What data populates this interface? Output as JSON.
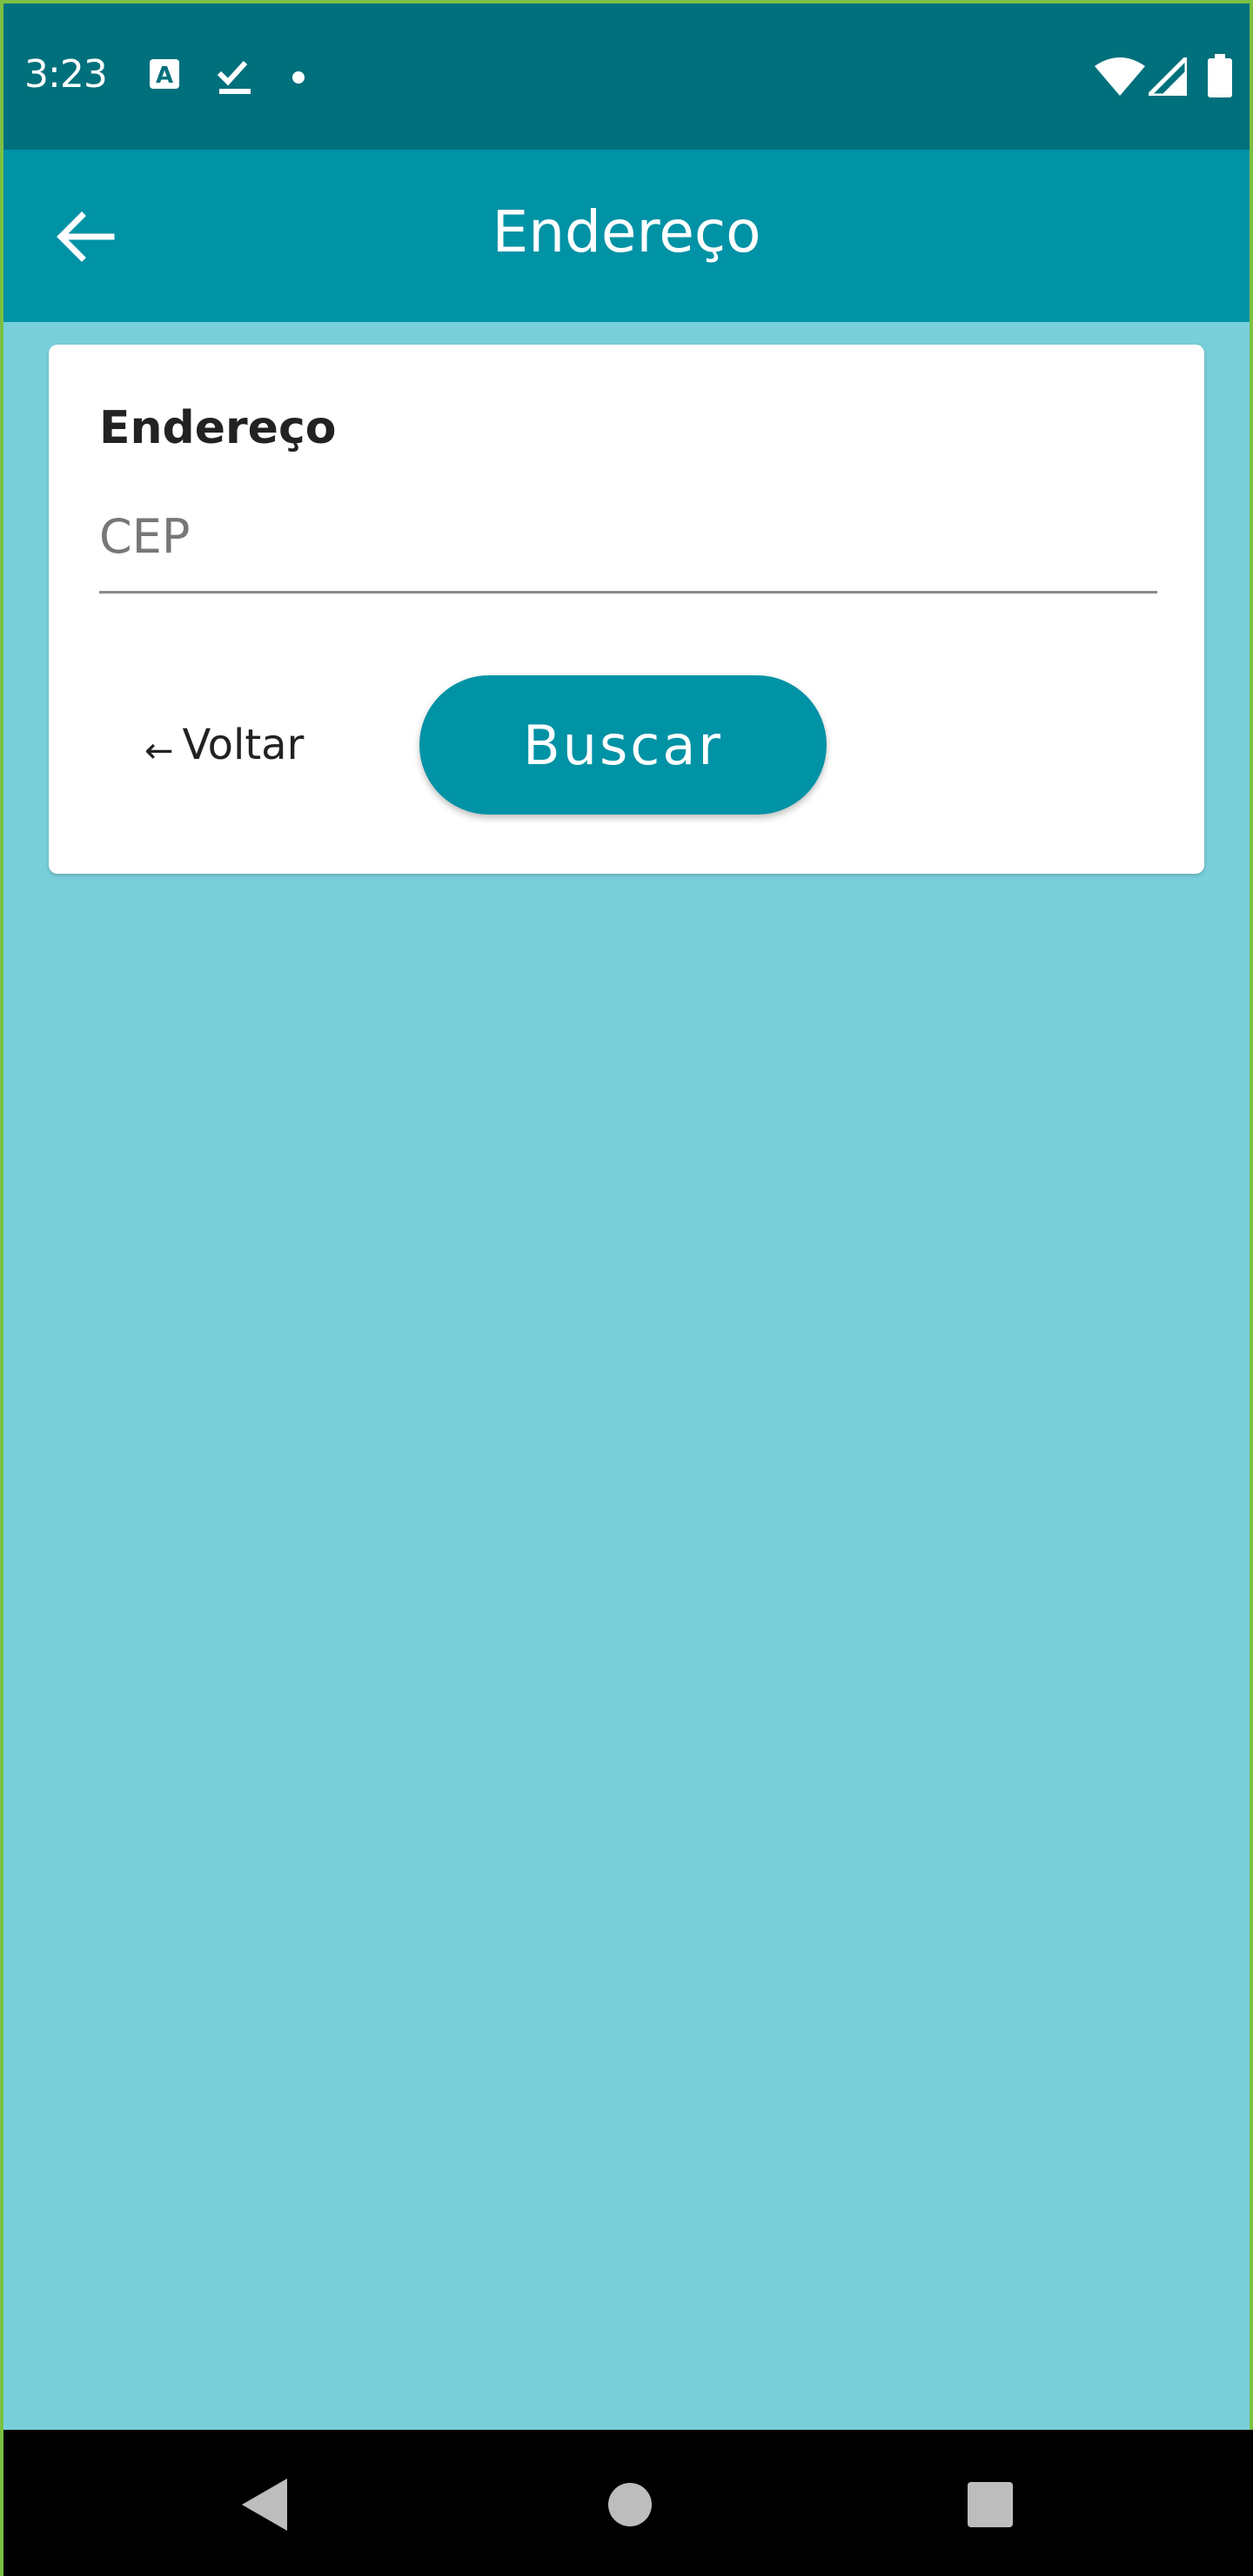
{
  "status_bar": {
    "time": "3:23",
    "icons": [
      "text-a-icon",
      "check-download-icon",
      "dot-icon",
      "wifi-icon",
      "signal-icon",
      "battery-icon"
    ]
  },
  "app_bar": {
    "title": "Endereço",
    "back_icon": "arrow-left-icon"
  },
  "card": {
    "title": "Endereço",
    "cep_placeholder": "CEP",
    "cep_value": "",
    "voltar_arrow": "←",
    "voltar_label": "Voltar",
    "buscar_label": "Buscar"
  },
  "nav_bar": {
    "icons": [
      "back-triangle-icon",
      "home-circle-icon",
      "recents-square-icon"
    ]
  },
  "colors": {
    "status_bar": "#00707c",
    "app_bar": "#0092a5",
    "background": "#78cfda",
    "button": "#0092a5",
    "card": "#ffffff"
  }
}
